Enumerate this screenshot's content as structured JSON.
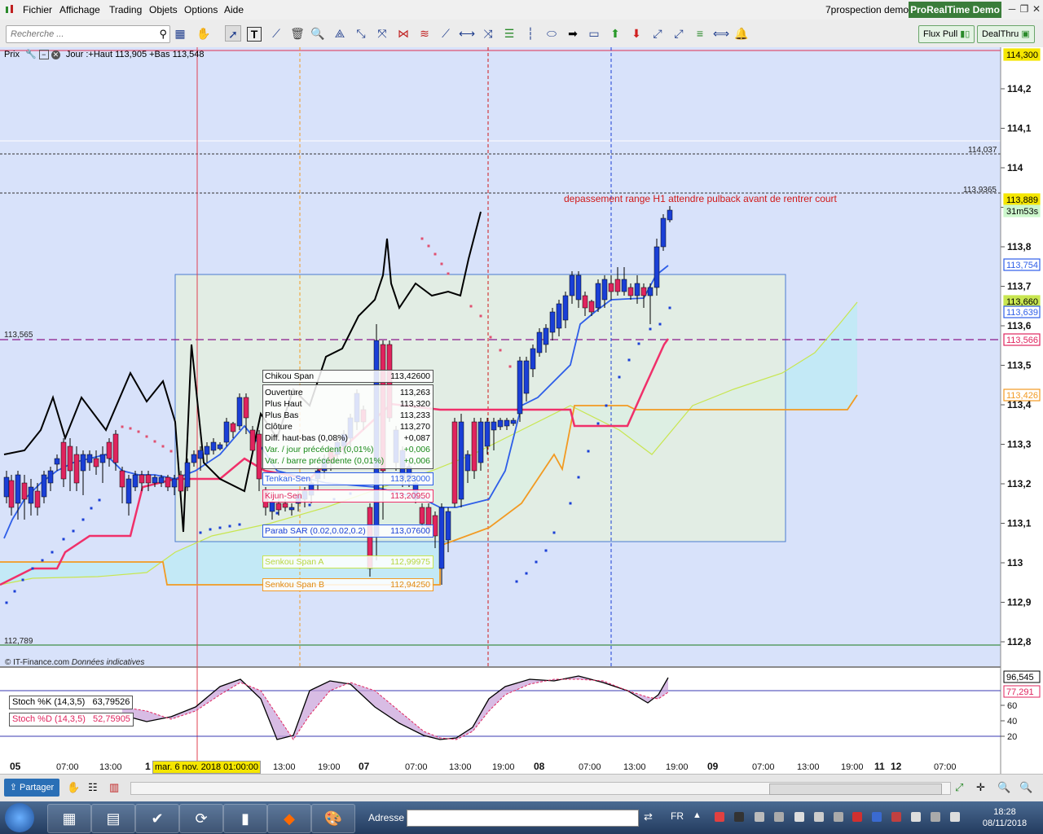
{
  "menu": {
    "items": [
      "Fichier",
      "Affichage",
      "Trading",
      "Objets",
      "Options",
      "Aide"
    ]
  },
  "window": {
    "account": "7prospection demo",
    "brand": "ProRealTime",
    "brand_mode": "Demo"
  },
  "toolbar": {
    "search_placeholder": "Recherche ...",
    "flux_pull": "Flux Pull",
    "dealthru": "DealThru",
    "icons": [
      "screener-icon",
      "hand-icon",
      "pointer-icon",
      "text-tool-icon",
      "ruler-icon",
      "trash-icon",
      "zoom-icon",
      "magnet-icon",
      "segment-icon",
      "fibonacci-icon",
      "fibonacci-fan-icon",
      "trend-line-icon",
      "horizontal-line-icon",
      "channel-icon",
      "regression-icon",
      "vertical-line-icon",
      "ellipse-icon",
      "arrow-right-icon",
      "rectangle-icon",
      "up-arrow-icon",
      "down-arrow-icon",
      "line-cross-icon",
      "pitchfork-icon",
      "expand-icon",
      "alert-bell-icon"
    ]
  },
  "chart": {
    "header_label": "Prix",
    "header_info": "Jour :+Haut 113,905 +Bas 113,548",
    "source": "© IT-Finance.com",
    "source_note": "Données indicatives",
    "annotation": "depassement range H1 attendre  pulback  avant de rentrer court",
    "level_113565": "113,565",
    "level_112789": "112,789",
    "hline_114037": "114,037",
    "hline_1139365": "113,9365",
    "y_ticks": [
      "114,2",
      "114,1",
      "114",
      "113,9",
      "113,8",
      "113,7",
      "113,6",
      "113,5",
      "113,4",
      "113,3",
      "113,2",
      "113,1",
      "113",
      "112,9",
      "112,8"
    ],
    "price_tags": [
      {
        "label": "114,300",
        "color": "#f5e600"
      },
      {
        "label": "113,889",
        "color": "#f5e600"
      },
      {
        "label": "31m53s",
        "color": "#ccf7cc"
      },
      {
        "label": "113,754",
        "color": "#2e5ee8"
      },
      {
        "label": "113,660",
        "color": "#c8e650"
      },
      {
        "label": "113,639",
        "color": "#2e5ee8"
      },
      {
        "label": "113,566",
        "color": "#e0245e"
      },
      {
        "label": "113,426",
        "color": "#f29a22"
      }
    ],
    "x_ticks": [
      "05",
      "07:00",
      "13:00",
      "1",
      "07",
      "07:00",
      "13:00",
      "19:00",
      "08",
      "07:00",
      "13:00",
      "19:00",
      "09",
      "07:00",
      "13:00",
      "19:00",
      "11",
      "12",
      "07:00"
    ],
    "x_ticks_mid": [
      "13:00",
      "19:00"
    ],
    "crosshair_date": "mar. 6 nov. 2018 01:00:00",
    "info_box": {
      "chikou_label": "Chikou Span",
      "chikou_value": "113,42600",
      "rows": [
        {
          "label": "Ouverture",
          "value": "113,263"
        },
        {
          "label": "Plus Haut",
          "value": "113,320"
        },
        {
          "label": "Plus Bas",
          "value": "113,233"
        },
        {
          "label": "Clôture",
          "value": "113,270"
        },
        {
          "label": "Diff. haut-bas (0,08%)",
          "value": "+0,087"
        },
        {
          "label": "Var. / jour précédent (0,01%)",
          "value": "+0,006"
        },
        {
          "label": "Var. / barre précédente (0,01%)",
          "value": "+0,006"
        }
      ],
      "tenkan_label": "Tenkan-Sen",
      "tenkan_value": "113,23000",
      "kijun_label": "Kijun-Sen",
      "kijun_value": "113,20950",
      "sar_label": "Parab SAR (0.02,0.02,0.2)",
      "sar_value": "113,07600",
      "senkou_a_label": "Senkou Span A",
      "senkou_a_value": "112,99975",
      "senkou_b_label": "Senkou Span B",
      "senkou_b_value": "112,94250"
    }
  },
  "stoch": {
    "k_label": "Stoch %K (14,3,5)",
    "k_value": "63,79526",
    "d_label": "Stoch %D (14,3,5)",
    "d_value": "52,75905",
    "tags": [
      {
        "label": "96,545",
        "color": "#ffffff"
      },
      {
        "label": "77,291",
        "color": "#ffffff"
      }
    ],
    "y_ticks": [
      "60",
      "40",
      "20"
    ]
  },
  "chartbar": {
    "share_label": "Partager"
  },
  "taskbar": {
    "address_label": "Adresse",
    "lang": "FR",
    "time": "18:28",
    "date": "08/11/2018"
  },
  "colors": {
    "blue_candle": "#1a3fd6",
    "red_candle": "#e0245e",
    "tenkan": "#2e5ee8",
    "kijun": "#f0306a",
    "senkou_a": "#c8e650",
    "senkou_b": "#f29a22",
    "chikou": "#000000",
    "cloud": "#b8ecf5",
    "range_box": "#e6f0dc"
  }
}
